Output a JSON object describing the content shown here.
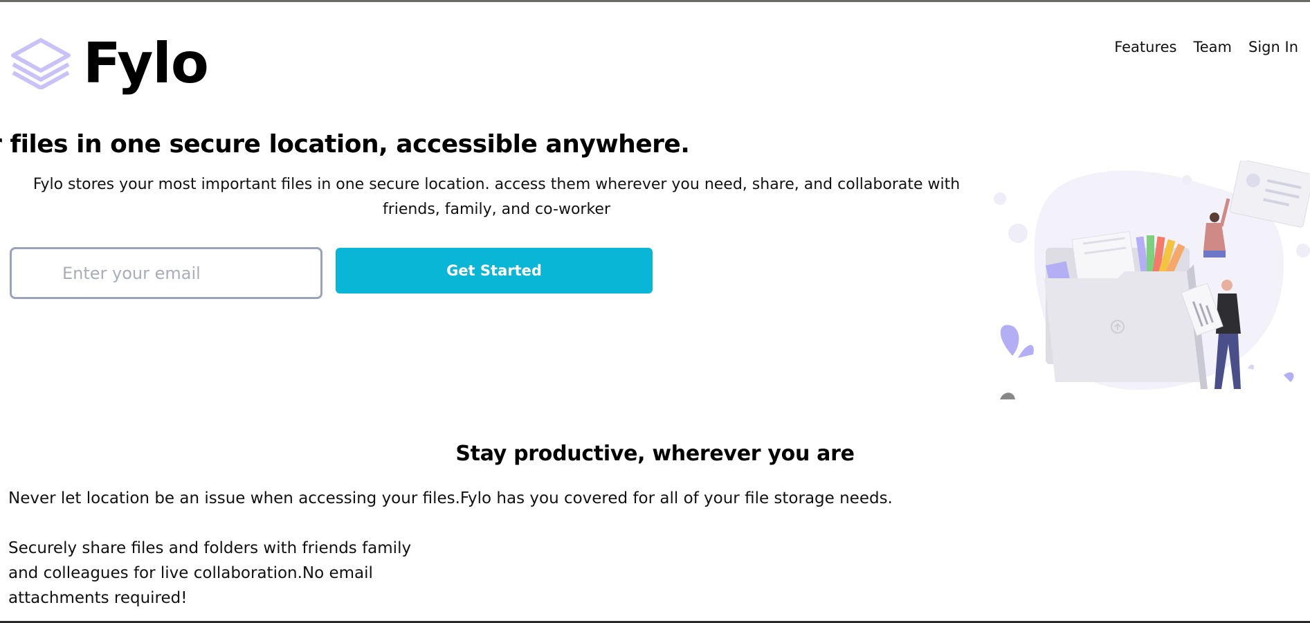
{
  "brand": {
    "name": "Fylo",
    "colors": {
      "accent": "#09b6d5",
      "logo_mark": "#c9c2f7",
      "text": "#111111"
    },
    "logo_icon": "layers-icon"
  },
  "nav": {
    "items": [
      {
        "label": "Features"
      },
      {
        "label": "Team"
      },
      {
        "label": "Sign In"
      }
    ]
  },
  "hero": {
    "title": "ur files in one secure location, accessible anywhere.",
    "description": "Fylo stores your most important files in one secure location. access them wherever you need, share, and collaborate with friends, family, and co-worker",
    "email_placeholder": "Enter your email",
    "cta_label": "Get Started",
    "illustration": "people-with-folder-illustration"
  },
  "productive": {
    "title": "Stay productive, wherever you are",
    "text": "Never let location be an issue when accessing your files.Fylo has you covered for all of your file storage needs.",
    "feature": "Securely share files and folders with friends family and colleagues for live collaboration.No email attachments required!"
  }
}
